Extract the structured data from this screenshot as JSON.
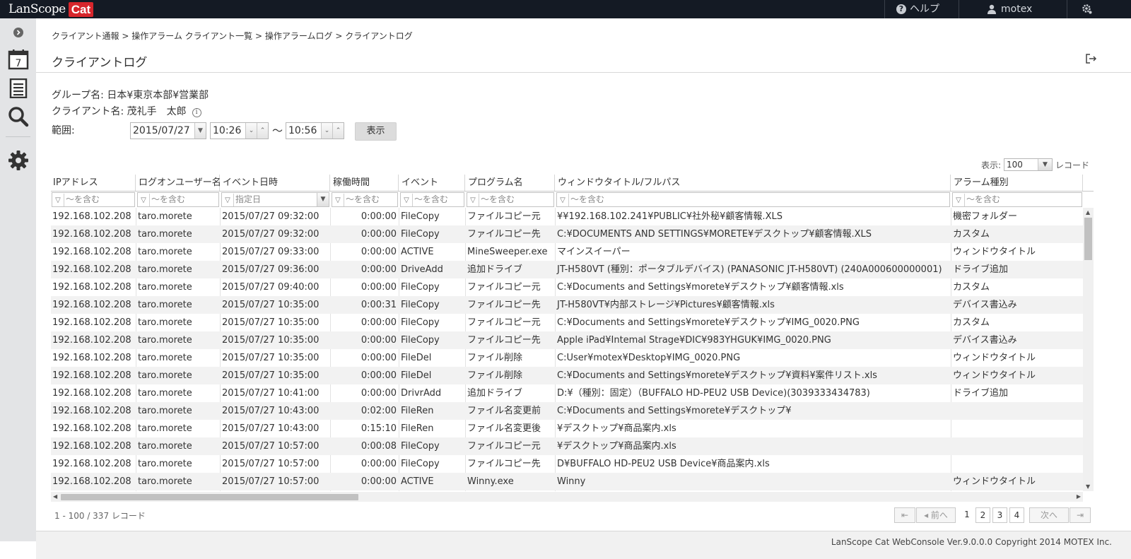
{
  "app": {
    "logo_primary": "LanScope",
    "logo_badge": "Cat",
    "help_label": "ヘルプ",
    "user_name": "motex"
  },
  "breadcrumb": "クライアント通報 > 操作アラーム クライアント一覧 > 操作アラームログ > クライアントログ",
  "page_title": "クライアントログ",
  "info": {
    "group": "グループ名:  日本¥東京本部¥営業部",
    "client": "クライアント名: 茂礼手　太郎",
    "range_label": "範囲:"
  },
  "range": {
    "date": "2015/07/27",
    "time_from": "10:26",
    "separator": "〜",
    "time_to": "10:56",
    "show_button": "表示"
  },
  "perpage": {
    "label": "表示:",
    "value": "100",
    "unit": "レコード"
  },
  "columns": [
    "IPアドレス",
    "ログオンユーザー名",
    "イベント日時",
    "稼働時間",
    "イベント",
    "プログラム名",
    "ウィンドウタイトル/フルパス",
    "アラーム種別"
  ],
  "filters": [
    "〜を含む",
    "〜を含む",
    "指定日",
    "〜を含む",
    "〜を含む",
    "〜を含む",
    "〜を含む",
    "〜を含む"
  ],
  "rows": [
    [
      "192.168.102.208",
      "taro.morete",
      "2015/07/27 09:32:00",
      "0:00:00",
      "FileCopy",
      "ファイルコピー元",
      "¥¥192.168.102.241¥PUBLIC¥社外秘¥顧客情報.XLS",
      "機密フォルダー"
    ],
    [
      "192.168.102.208",
      "taro.morete",
      "2015/07/27 09:32:00",
      "0:00:00",
      "FileCopy",
      "ファイルコピー先",
      "C:¥DOCUMENTS AND SETTINGS¥MORETE¥デスクトップ¥顧客情報.XLS",
      "カスタム"
    ],
    [
      "192.168.102.208",
      "taro.morete",
      "2015/07/27 09:33:00",
      "0:00:00",
      "ACTIVE",
      "MineSweeper.exe",
      "マインスイーパー",
      "ウィンドウタイトル"
    ],
    [
      "192.168.102.208",
      "taro.morete",
      "2015/07/27 09:36:00",
      "0:00:00",
      "DriveAdd",
      "追加ドライブ",
      "JT-H580VT (種別：ポータブルデバイス) (PANASONIC JT-H580VT) (240A000600000001)",
      "ドライブ追加"
    ],
    [
      "192.168.102.208",
      "taro.morete",
      "2015/07/27 09:40:00",
      "0:00:00",
      "FileCopy",
      "ファイルコピー元",
      "C:¥Documents and Settings¥morete¥デスクトップ¥顧客情報.xls",
      "カスタム"
    ],
    [
      "192.168.102.208",
      "taro.morete",
      "2015/07/27 10:35:00",
      "0:00:31",
      "FileCopy",
      "ファイルコピー先",
      "JT-H580VT¥内部ストレージ¥Pictures¥顧客情報.xls",
      "デバイス書込み"
    ],
    [
      "192.168.102.208",
      "taro.morete",
      "2015/07/27 10:35:00",
      "0:00:00",
      "FileCopy",
      "ファイルコピー元",
      "C:¥Documents and Settings¥morete¥デスクトップ¥IMG_0020.PNG",
      "カスタム"
    ],
    [
      "192.168.102.208",
      "taro.morete",
      "2015/07/27 10:35:00",
      "0:00:00",
      "FileCopy",
      "ファイルコピー先",
      "Apple iPad¥Intemal Strage¥DIC¥983YHGUK¥IMG_0020.PNG",
      "デバイス書込み"
    ],
    [
      "192.168.102.208",
      "taro.morete",
      "2015/07/27 10:35:00",
      "0:00:00",
      "FileDel",
      "ファイル削除",
      "C:User¥motex¥Desktop¥IMG_0020.PNG",
      "ウィンドウタイトル"
    ],
    [
      "192.168.102.208",
      "taro.morete",
      "2015/07/27 10:35:00",
      "0:00:00",
      "FileDel",
      "ファイル削除",
      "C:¥Documents and Settings¥morete¥デスクトップ¥資料¥案件リスト.xls",
      "ウィンドウタイトル"
    ],
    [
      "192.168.102.208",
      "taro.morete",
      "2015/07/27 10:41:00",
      "0:00:00",
      "DrivrAdd",
      "追加ドライブ",
      "D:¥（種別：固定）（BUFFALO HD-PEU2 USB Device)(3039333434783)",
      "ドライブ追加"
    ],
    [
      "192.168.102.208",
      "taro.morete",
      "2015/07/27 10:43:00",
      "0:02:00",
      "FileRen",
      "ファイル名変更前",
      "C:¥Documents and Settings¥morete¥デスクトップ¥",
      ""
    ],
    [
      "192.168.102.208",
      "taro.morete",
      "2015/07/27 10:43:00",
      "0:15:10",
      "FileRen",
      "ファイル名変更後",
      "¥デスクトップ¥商品案内.xls",
      ""
    ],
    [
      "192.168.102.208",
      "taro.morete",
      "2015/07/27 10:57:00",
      "0:00:08",
      "FileCopy",
      "ファイルコピー元",
      "¥デスクトップ¥商品案内.xls",
      ""
    ],
    [
      "192.168.102.208",
      "taro.morete",
      "2015/07/27 10:57:00",
      "0:00:00",
      "FileCopy",
      "ファイルコピー先",
      "D¥BUFFALO HD-PEU2 USB Device¥商品案内.xls",
      ""
    ],
    [
      "192.168.102.208",
      "taro.morete",
      "2015/07/27 10:57:00",
      "0:00:00",
      "ACTIVE",
      "Winny.exe",
      "Winny",
      "ウィンドウタイトル"
    ]
  ],
  "record_count": "1 - 100 / 337 レコード",
  "pagination": {
    "first": "⇤",
    "prev": "◂ 前へ",
    "pages": [
      "1",
      "2",
      "3",
      "4"
    ],
    "next": "次へ",
    "last": "⇥"
  },
  "footer": "LanScope Cat WebConsole Ver.9.0.0.0 Copyright 2014 MOTEX Inc."
}
